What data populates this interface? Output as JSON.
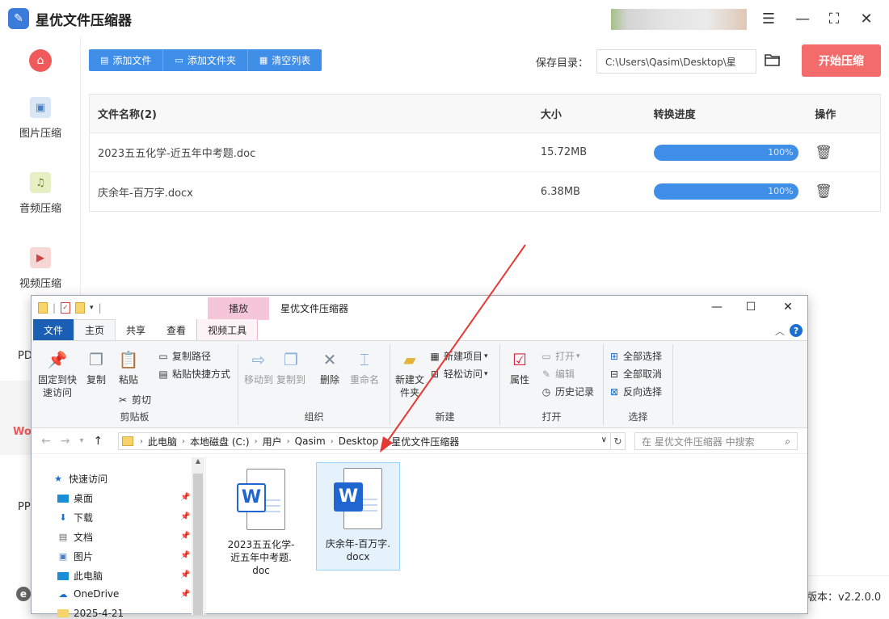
{
  "app": {
    "title": "星优文件压缩器",
    "logo_icon": "app-logo-icon"
  },
  "window_controls": {
    "settings": "☰",
    "minimize": "—",
    "maximize": "⛶",
    "close": "✕"
  },
  "sidebar": {
    "items": [
      {
        "label": "图片压缩"
      },
      {
        "label": "音频压缩"
      },
      {
        "label": "视频压缩"
      }
    ],
    "partial_labels": [
      "PD",
      "Wo",
      "PP"
    ]
  },
  "toolbar": {
    "add_file": "添加文件",
    "add_folder": "添加文件夹",
    "clear_list": "清空列表"
  },
  "save": {
    "label": "保存目录：",
    "path": "C:\\Users\\Qasim\\Desktop\\星"
  },
  "start_button": "开始压缩",
  "table": {
    "headers": {
      "name": "文件名称(2)",
      "size": "大小",
      "progress": "转换进度",
      "action": "操作"
    },
    "rows": [
      {
        "name": "2023五五化学-近五年中考题.doc",
        "size": "15.72MB",
        "progress": 1.0,
        "progress_label": "100%"
      },
      {
        "name": "庆余年-百万字.docx",
        "size": "6.38MB",
        "progress": 1.0,
        "progress_label": "100%"
      }
    ]
  },
  "footer": {
    "version": "版本：v2.2.0.0"
  },
  "explorer": {
    "context_tab": "播放",
    "window_title": "星优文件压缩器",
    "tabs": {
      "file": "文件",
      "home": "主页",
      "share": "共享",
      "view": "查看",
      "video_tools": "视频工具"
    },
    "ribbon": {
      "pin_quick": "固定到快速访问",
      "copy": "复制",
      "paste": "粘贴",
      "copy_path": "复制路径",
      "paste_shortcut": "粘贴快捷方式",
      "cut": "剪切",
      "clipboard": "剪贴板",
      "move_to": "移动到",
      "copy_to": "复制到",
      "delete": "删除",
      "rename": "重命名",
      "organize": "组织",
      "new_folder": "新建文件夹",
      "new_item": "新建项目",
      "easy_access": "轻松访问",
      "new": "新建",
      "properties": "属性",
      "open_btn": "打开",
      "edit": "编辑",
      "history": "历史记录",
      "open": "打开",
      "select_all": "全部选择",
      "select_none": "全部取消",
      "invert": "反向选择",
      "select": "选择"
    },
    "address": [
      "此电脑",
      "本地磁盘 (C:)",
      "用户",
      "Qasim",
      "Desktop",
      "星优文件压缩器"
    ],
    "search_placeholder": "在 星优文件压缩器 中搜索",
    "nav": [
      {
        "label": "快速访问"
      },
      {
        "label": "桌面"
      },
      {
        "label": "下载"
      },
      {
        "label": "文档"
      },
      {
        "label": "图片"
      },
      {
        "label": "此电脑"
      },
      {
        "label": "OneDrive"
      },
      {
        "label": "2025-4-21"
      }
    ],
    "files": [
      {
        "line1": "2023五五化学-",
        "line2": "近五年中考题.",
        "line3": "doc"
      },
      {
        "line1": "庆余年-百万字.",
        "line2": "docx"
      }
    ]
  },
  "colors": {
    "accent": "#3f8ee8",
    "start": "#f36b6b",
    "home": "#f05a5a",
    "arrow": "#e53935"
  }
}
